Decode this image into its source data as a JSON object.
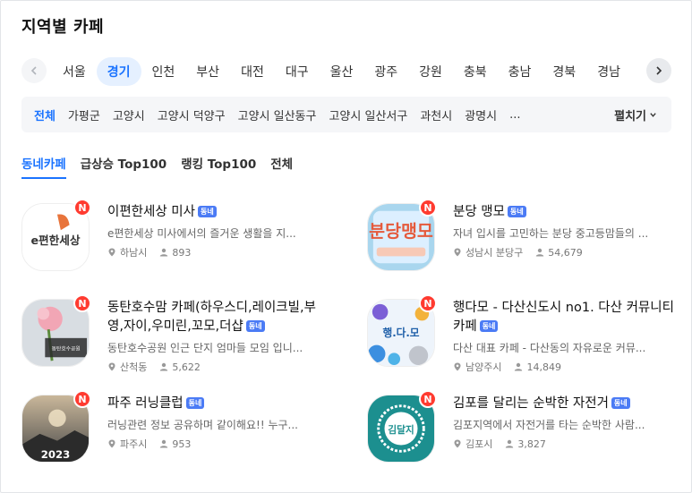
{
  "title": "지역별 카페",
  "regions": [
    "서울",
    "경기",
    "인천",
    "부산",
    "대전",
    "대구",
    "울산",
    "광주",
    "강원",
    "충북",
    "충남",
    "경북",
    "경남"
  ],
  "active_region": "경기",
  "subregions": [
    "전체",
    "가평군",
    "고양시",
    "고양시 덕양구",
    "고양시 일산동구",
    "고양시 일산서구",
    "과천시",
    "광명시"
  ],
  "subregion_more": "...",
  "expand_label": "펼치기",
  "tabs": [
    "동네카페",
    "급상승 Top100",
    "랭킹 Top100",
    "전체"
  ],
  "badge_label": "N",
  "tag_label": "동네",
  "cafes": [
    {
      "name": "이편한세상 미사",
      "desc": "e편한세상 미사에서의 즐거운 생활을 지...",
      "location": "하남시",
      "members": "893",
      "thumb_text": "e편한세상"
    },
    {
      "name": "분당 맹모",
      "desc": "자녀 입시를 고민하는 분당 중고등맘들의 ...",
      "location": "성남시 분당구",
      "members": "54,679",
      "thumb_text": "분당맹모"
    },
    {
      "name": "동탄호수맘 카페(하우스디,레이크빌,부영,자이,우미린,꼬모,더샵",
      "desc": "동탄호수공원 인근 단지 엄마들 모임 입니...",
      "location": "산척동",
      "members": "5,622",
      "thumb_text": "동탄호수공원"
    },
    {
      "name": "행다모 - 다산신도시 no1. 다산 커뮤니티 카페",
      "desc": "다산 대표 카페 - 다산동의 자유로운 커뮤...",
      "location": "남양주시",
      "members": "14,849",
      "thumb_text": "행.다.모"
    },
    {
      "name": "파주 러닝클럽",
      "desc": "러닝관련 정보 공유하며 같이해요!! 누구...",
      "location": "파주시",
      "members": "953",
      "thumb_text": "2023"
    },
    {
      "name": "김포를 달리는 순박한 자전거",
      "desc": "김포지역에서 자전거를 타는 순박한 사람...",
      "location": "김포시",
      "members": "3,827",
      "thumb_text": "김달지"
    }
  ]
}
